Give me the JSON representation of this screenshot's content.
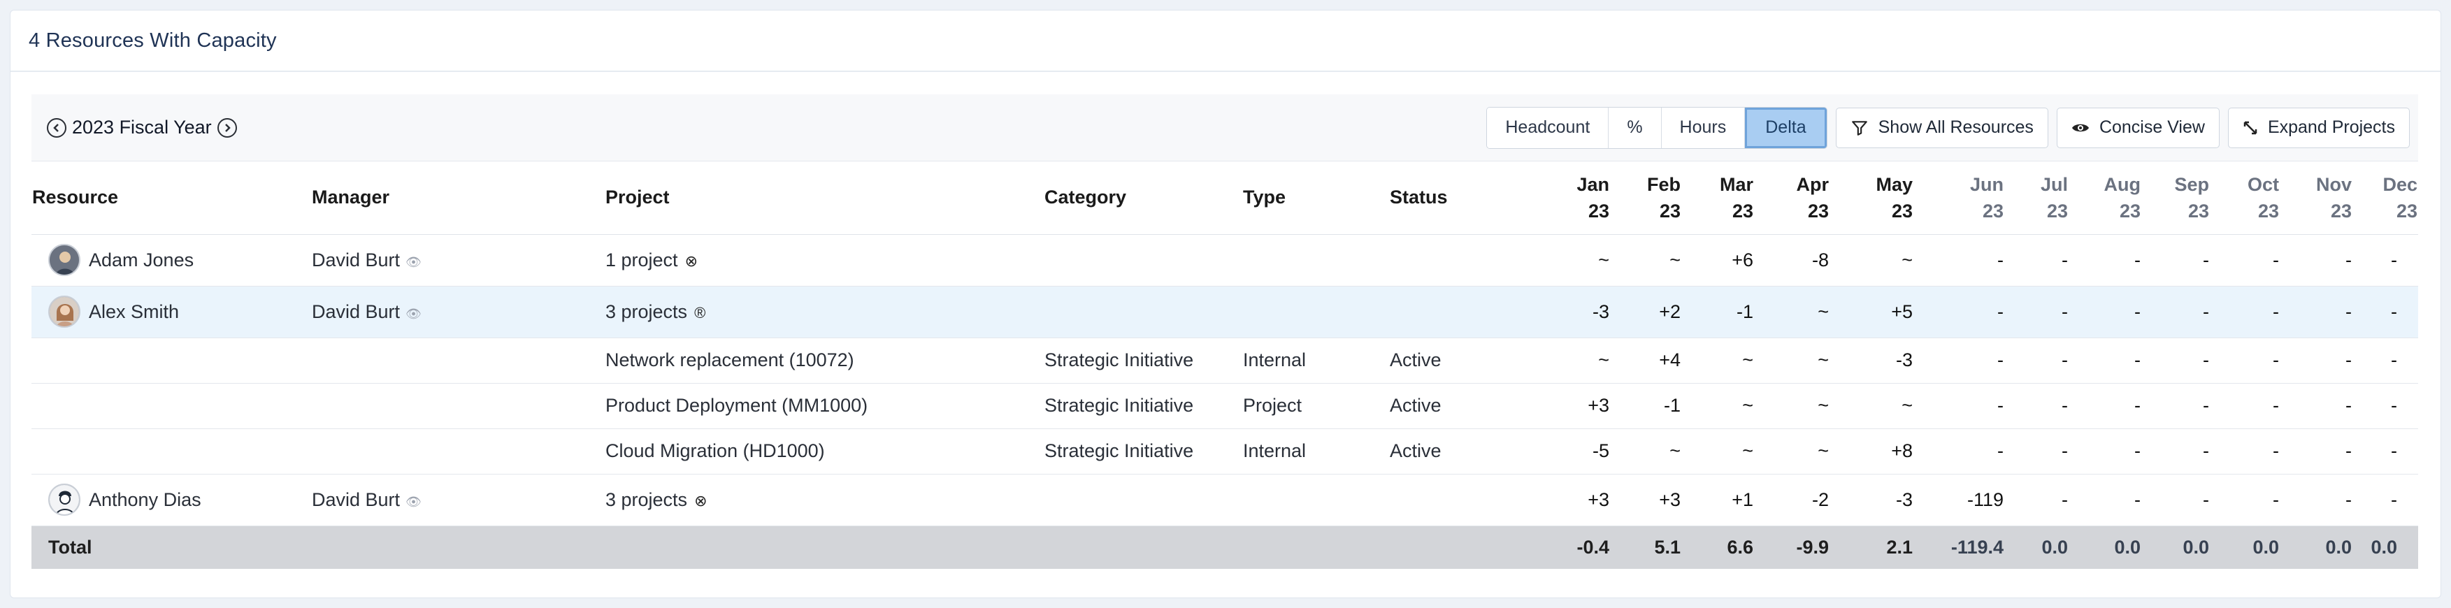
{
  "header": {
    "title": "4 Resources With Capacity"
  },
  "toolbar": {
    "fiscal_year": "2023 Fiscal Year",
    "modes": [
      "Headcount",
      "%",
      "Hours",
      "Delta"
    ],
    "active_mode": "Delta",
    "show_all": "Show All Resources",
    "concise": "Concise View",
    "expand": "Expand Projects"
  },
  "columns": {
    "resource": "Resource",
    "manager": "Manager",
    "project": "Project",
    "category": "Category",
    "type": "Type",
    "status": "Status",
    "months": [
      {
        "m": "Jan",
        "y": "23"
      },
      {
        "m": "Feb",
        "y": "23"
      },
      {
        "m": "Mar",
        "y": "23"
      },
      {
        "m": "Apr",
        "y": "23"
      },
      {
        "m": "May",
        "y": "23"
      },
      {
        "m": "Jun",
        "y": "23"
      },
      {
        "m": "Jul",
        "y": "23"
      },
      {
        "m": "Aug",
        "y": "23"
      },
      {
        "m": "Sep",
        "y": "23"
      },
      {
        "m": "Oct",
        "y": "23"
      },
      {
        "m": "Nov",
        "y": "23"
      },
      {
        "m": "Dec",
        "y": "23"
      }
    ]
  },
  "rows": {
    "adam": {
      "name": "Adam Jones",
      "manager": "David Burt",
      "project": "1 project",
      "values": [
        "~",
        "~",
        "+6",
        "-8",
        "~",
        "-",
        "-",
        "-",
        "-",
        "-",
        "-",
        "-"
      ]
    },
    "alex": {
      "name": "Alex Smith",
      "manager": "David Burt",
      "project": "3 projects",
      "values": [
        "-3",
        "+2",
        "-1",
        "~",
        "+5",
        "-",
        "-",
        "-",
        "-",
        "-",
        "-",
        "-"
      ]
    },
    "net": {
      "project": "Network replacement (10072)",
      "category": "Strategic Initiative",
      "type": "Internal",
      "status": "Active",
      "values": [
        "~",
        "+4",
        "~",
        "~",
        "-3",
        "-",
        "-",
        "-",
        "-",
        "-",
        "-",
        "-"
      ]
    },
    "prod": {
      "project": "Product Deployment (MM1000)",
      "category": "Strategic Initiative",
      "type": "Project",
      "status": "Active",
      "values": [
        "+3",
        "-1",
        "~",
        "~",
        "~",
        "-",
        "-",
        "-",
        "-",
        "-",
        "-",
        "-"
      ]
    },
    "cloud": {
      "project": "Cloud Migration (HD1000)",
      "category": "Strategic Initiative",
      "type": "Internal",
      "status": "Active",
      "values": [
        "-5",
        "~",
        "~",
        "~",
        "+8",
        "-",
        "-",
        "-",
        "-",
        "-",
        "-",
        "-"
      ]
    },
    "anthony": {
      "name": "Anthony Dias",
      "manager": "David Burt",
      "project": "3 projects",
      "values": [
        "+3",
        "+3",
        "+1",
        "-2",
        "-3",
        "-119",
        "-",
        "-",
        "-",
        "-",
        "-",
        "-"
      ]
    }
  },
  "total": {
    "label": "Total",
    "values": [
      "-0.4",
      "5.1",
      "6.6",
      "-9.9",
      "2.1",
      "-119.4",
      "0.0",
      "0.0",
      "0.0",
      "0.0",
      "0.0",
      "0.0"
    ]
  },
  "colors": {
    "positive": "#c0231b",
    "green": "#1c7a3a",
    "active_mode_bg": "#a9cdf2"
  }
}
